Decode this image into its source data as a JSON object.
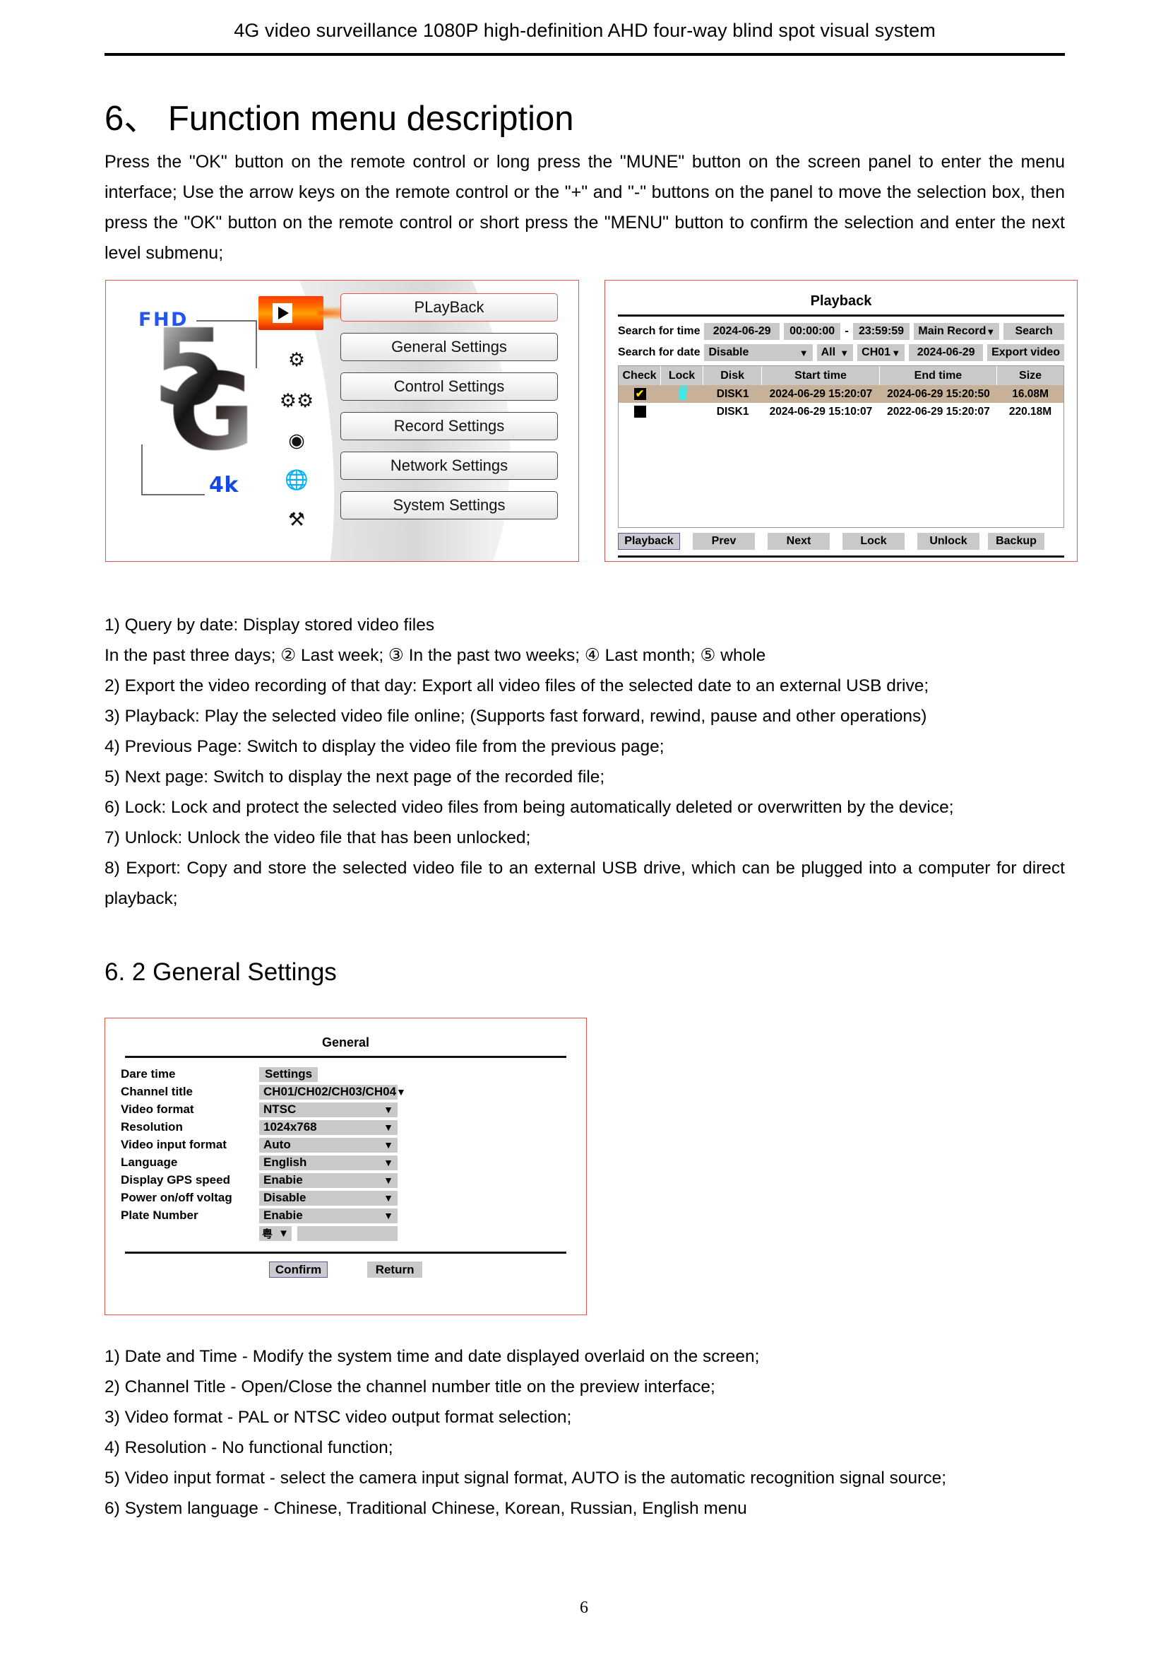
{
  "doc": {
    "running_header": "4G video surveillance 1080P high-definition AHD four-way blind spot visual system",
    "page_number": "6"
  },
  "section6": {
    "heading": "6、 Function menu description",
    "intro": "Press the \"OK\" button on the remote control or long press the \"MUNE\" button on the screen panel to enter the menu interface; Use the arrow keys on the remote control or the \"+\" and \"-\" buttons on the panel to move the selection box, then press the \"OK\" button on the remote control or short press the \"MENU\" button to confirm the selection and enter the next level submenu;"
  },
  "menu_figure": {
    "logo": {
      "fhd": "FHD",
      "mark": "5",
      "mark2": "G",
      "fourk": "4k"
    },
    "icons": [
      "play-icon",
      "gear-icon",
      "double-gear-icon",
      "camera-icon",
      "globe-icon",
      "tools-icon"
    ],
    "buttons": [
      {
        "label": "PLayBack",
        "active": true
      },
      {
        "label": "General Settings",
        "active": false
      },
      {
        "label": "Control Settings",
        "active": false
      },
      {
        "label": "Record Settings",
        "active": false
      },
      {
        "label": "Network Settings",
        "active": false
      },
      {
        "label": "System Settings",
        "active": false
      }
    ]
  },
  "playback_figure": {
    "title": "Playback",
    "search_time": {
      "label": "Search for time",
      "date": "2024-06-29",
      "from": "00:00:00",
      "separator": "-",
      "to": "23:59:59",
      "record_type": "Main Record",
      "caret": "▼",
      "search_button": "Search"
    },
    "search_date": {
      "label": "Search for date",
      "range": "Disable",
      "caret": "▼",
      "all": "All",
      "channel": "CH01",
      "date": "2024-06-29",
      "export_button": "Export video"
    },
    "table": {
      "headers": [
        "Check",
        "Lock",
        "Disk",
        "Start time",
        "End time",
        "Size"
      ],
      "rows": [
        {
          "checked": true,
          "locked": true,
          "disk": "DISK1",
          "start": "2024-06-29  15:20:07",
          "end": "2024-06-29  15:20:50",
          "size": "16.08M",
          "selected": true
        },
        {
          "checked": false,
          "locked": false,
          "disk": "DISK1",
          "start": "2024-06-29  15:10:07",
          "end": "2022-06-29  15:20:07",
          "size": "220.18M",
          "selected": false
        }
      ]
    },
    "buttons": [
      "Playback",
      "Prev",
      "Next",
      "Lock",
      "Unlock",
      "Backup"
    ]
  },
  "playback_notes": [
    "1) Query by date: Display stored video files",
    "In the past three days; ② Last week; ③ In the past two weeks; ④ Last month; ⑤ whole",
    "2) Export the video recording of that day: Export all video files of the selected date to an external USB drive;",
    "3) Playback: Play the selected video file online; (Supports fast forward, rewind, pause and other operations)",
    "4) Previous Page: Switch to display the video file from the previous page;",
    "5) Next page: Switch to display the next page of the recorded file;",
    "6) Lock: Lock and protect the selected video files from being automatically deleted or overwritten by the device;",
    "7) Unlock: Unlock the video file that has been unlocked;",
    "8) Export: Copy and store the selected video file to an external USB drive, which can be plugged into a computer for direct playback;"
  ],
  "section62": {
    "heading": "6. 2  General Settings"
  },
  "general_figure": {
    "title": "General",
    "rows": [
      {
        "label": "Dare time",
        "value": "Settings",
        "caret": "",
        "auto": true
      },
      {
        "label": "Channel title",
        "value": "CH01/CH02/CH03/CH04",
        "caret": "▼",
        "auto": false
      },
      {
        "label": "Video format",
        "value": "NTSC",
        "caret": "▼",
        "auto": false
      },
      {
        "label": "Resolution",
        "value": "1024x768",
        "caret": "▼",
        "auto": false
      },
      {
        "label": "Video input format",
        "value": "Auto",
        "caret": "▼",
        "auto": false
      },
      {
        "label": "Language",
        "value": "English",
        "caret": "▼",
        "auto": false
      },
      {
        "label": "Display GPS speed",
        "value": "Enabie",
        "caret": "▼",
        "auto": false
      },
      {
        "label": "Power on/off voltag",
        "value": "Disable",
        "caret": "▼",
        "auto": false
      },
      {
        "label": "Plate Number",
        "value": "Enabie",
        "caret": "▼",
        "auto": false
      }
    ],
    "plate": {
      "prefix": "粤",
      "caret": "▼",
      "input_value": ""
    },
    "confirm_button": "Confirm",
    "return_button": "Return"
  },
  "general_notes": [
    "1) Date and Time - Modify the system time and date displayed overlaid on the screen;",
    "2) Channel Title - Open/Close the channel number title on the preview interface;",
    "3) Video format - PAL or NTSC video output format selection;",
    "4) Resolution - No functional function;",
    "5) Video input format - select the camera input signal format, AUTO is the automatic recognition signal source;",
    "6) System language - Chinese, Traditional Chinese, Korean, Russian, English menu"
  ],
  "colors": {
    "figure_border": "#e0554e",
    "field_gray": "#c9c9c9",
    "selected_row": "#c7b299",
    "accent_blue": "#2554f0",
    "hot_orange": "#ff6a00"
  }
}
